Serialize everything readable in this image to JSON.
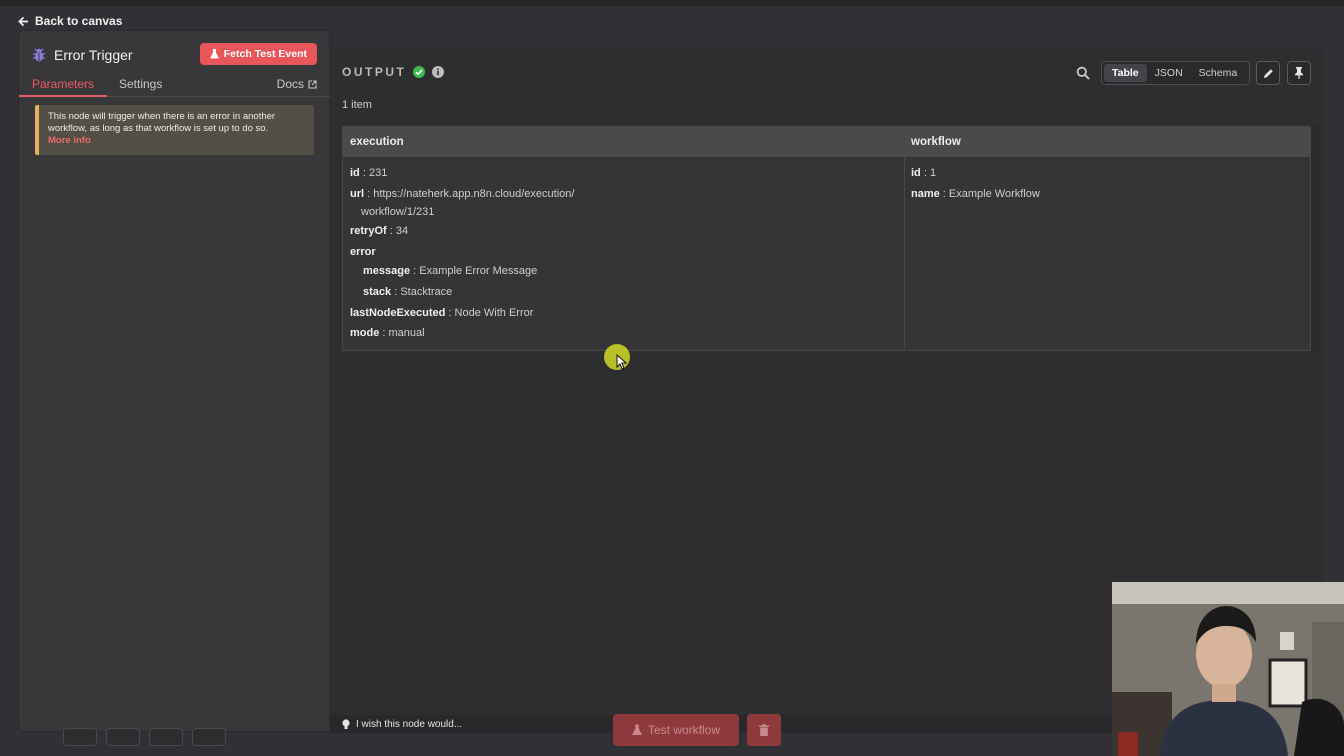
{
  "back": {
    "label": "Back to canvas"
  },
  "node": {
    "title": "Error Trigger",
    "fetch_label": "Fetch Test Event",
    "tabs": [
      {
        "label": "Parameters",
        "active": true
      },
      {
        "label": "Settings",
        "active": false
      }
    ],
    "docs_label": "Docs",
    "notice": {
      "text": "This node will trigger when there is an error in another workflow, as long as that workflow is set up to do so.",
      "more": "More info"
    }
  },
  "output": {
    "title": "OUTPUT",
    "item_count": "1 item",
    "views": [
      "Table",
      "JSON",
      "Schema"
    ],
    "active_view": "Table",
    "columns": [
      "execution",
      "workflow"
    ],
    "execution": {
      "id_key": "id",
      "id_val": "231",
      "url_key": "url",
      "url_val_1": "https://nateherk.app.n8n.cloud/execution/",
      "url_val_2": "workflow/1/231",
      "retry_key": "retryOf",
      "retry_val": "34",
      "error_key": "error",
      "message_key": "message",
      "message_val": "Example Error Message",
      "stack_key": "stack",
      "stack_val": "Stacktrace",
      "last_key": "lastNodeExecuted",
      "last_val": "Node With Error",
      "mode_key": "mode",
      "mode_val": "manual"
    },
    "workflow": {
      "id_key": "id",
      "id_val": "1",
      "name_key": "name",
      "name_val": "Example Workflow"
    }
  },
  "footer": {
    "wish": "I wish this node would...",
    "test_workflow": "Test workflow"
  },
  "colors": {
    "accent": "#ea5b5f",
    "success": "#3fb950",
    "warning": "#e0b35a"
  }
}
